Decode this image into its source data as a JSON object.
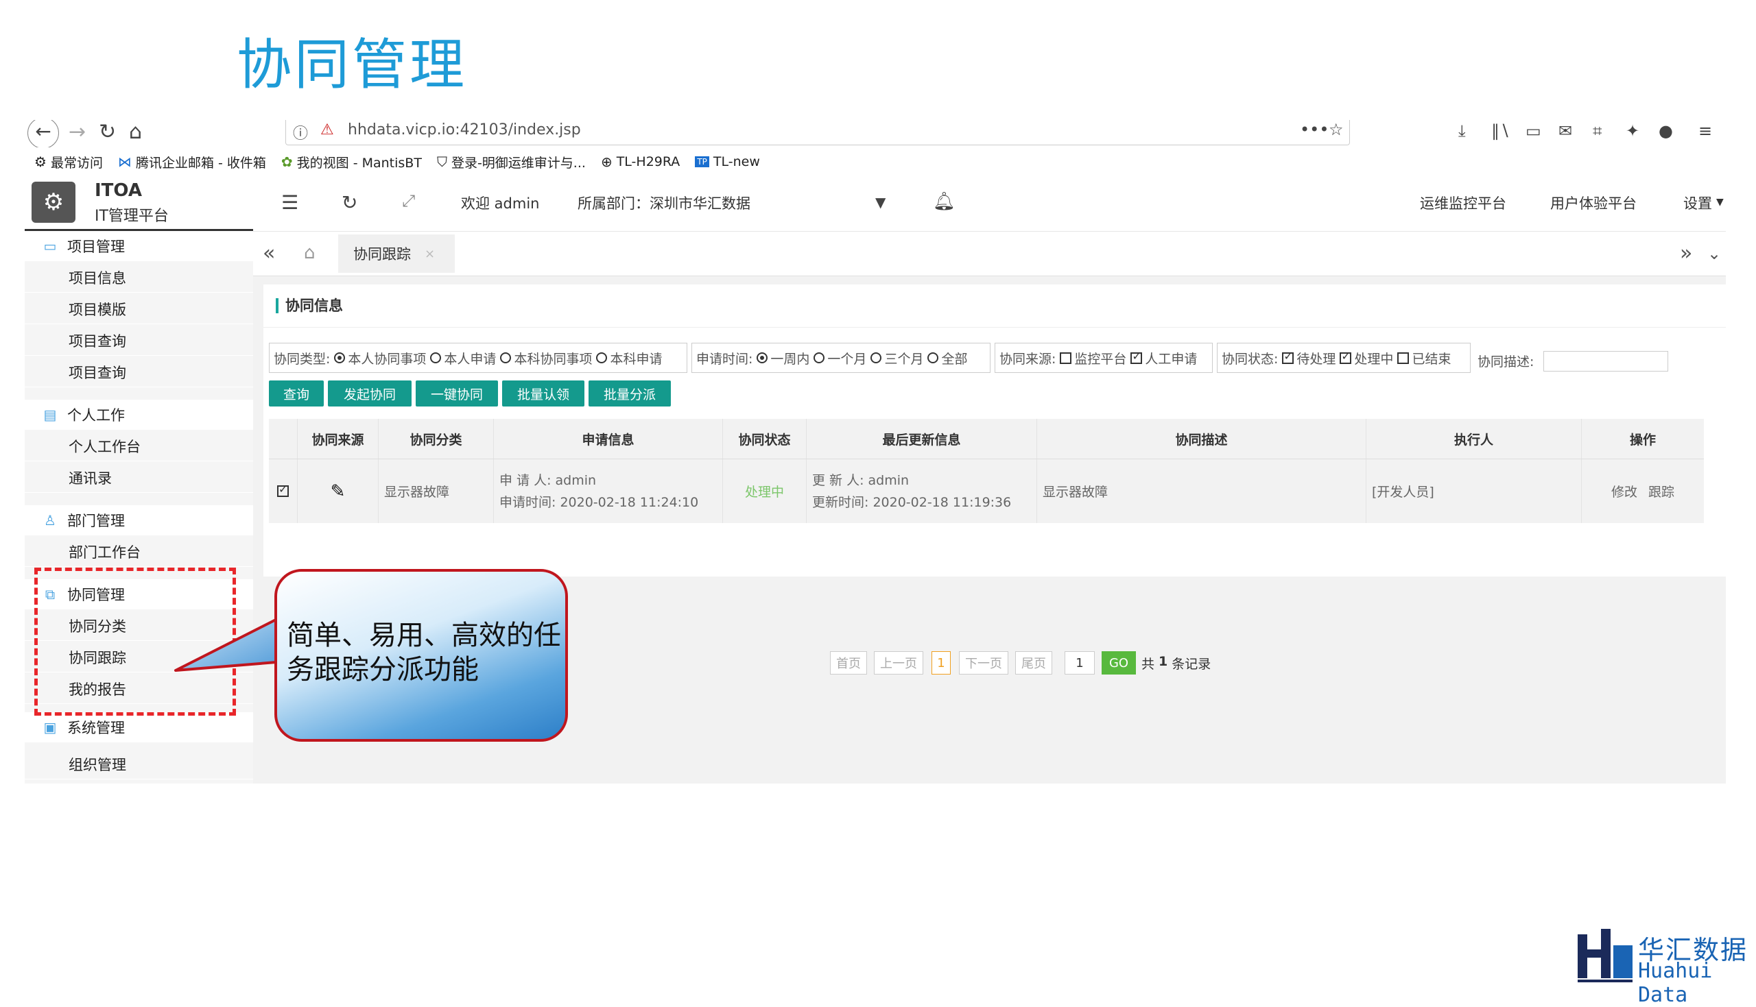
{
  "slide": {
    "title": "协同管理"
  },
  "browser": {
    "url": "hhdata.vicp.io:42103/index.jsp",
    "bookmarks": [
      {
        "icon": "gear-icon",
        "label": "最常访问"
      },
      {
        "icon": "mail-icon",
        "label": "腾讯企业邮箱 - 收件箱"
      },
      {
        "icon": "bug-icon",
        "label": "我的视图 - MantisBT"
      },
      {
        "icon": "shield-icon",
        "label": "登录-明御运维审计与..."
      },
      {
        "icon": "globe-icon",
        "label": "TL-H29RA"
      },
      {
        "icon": "tp-icon",
        "label": "TL-new"
      }
    ]
  },
  "app": {
    "logo_title": "ITOA",
    "logo_subtitle": "IT管理平台",
    "welcome": "欢迎 admin",
    "department": "所属部门：深圳市华汇数据",
    "header_links": [
      "运维监控平台",
      "用户体验平台",
      "设置"
    ]
  },
  "sidebar": {
    "groups": [
      {
        "label": "项目管理",
        "items": [
          "项目信息",
          "项目模版",
          "项目查询",
          "项目查询"
        ]
      },
      {
        "label": "个人工作",
        "items": [
          "个人工作台",
          "通讯录"
        ]
      },
      {
        "label": "部门管理",
        "items": [
          "部门工作台"
        ]
      },
      {
        "label": "协同管理",
        "items": [
          "协同分类",
          "协同跟踪",
          "我的报告"
        ]
      },
      {
        "label": "系统管理",
        "items": [
          "组织管理"
        ]
      }
    ]
  },
  "tabs": {
    "active": "协同跟踪"
  },
  "panel": {
    "title": "协同信息",
    "filters": {
      "type_label": "协同类型:",
      "type_options": [
        "本人协同事项",
        "本人申请",
        "本科协同事项",
        "本科申请"
      ],
      "time_label": "申请时间:",
      "time_options": [
        "一周内",
        "一个月",
        "三个月",
        "全部"
      ],
      "source_label": "协同来源:",
      "source_options": [
        "监控平台",
        "人工申请"
      ],
      "status_label": "协同状态:",
      "status_options": [
        "待处理",
        "处理中",
        "已结束"
      ],
      "desc_label": "协同描述:"
    },
    "buttons": [
      "查询",
      "发起协同",
      "一键协同",
      "批量认领",
      "批量分派"
    ],
    "table": {
      "headers": [
        "协同来源",
        "协同分类",
        "申请信息",
        "协同状态",
        "最后更新信息",
        "协同描述",
        "执行人",
        "操作"
      ],
      "rows": [
        {
          "category": "显示器故障",
          "applicant": "申 请 人: admin",
          "apply_time": "申请时间: 2020-02-18 11:24:10",
          "status": "处理中",
          "updater": "更 新 人: admin",
          "update_time": "更新时间: 2020-02-18 11:19:36",
          "description": "显示器故障",
          "executor": "[开发人员]",
          "action_edit": "修改",
          "action_track": "跟踪"
        }
      ]
    },
    "pagination": {
      "first": "首页",
      "prev": "上一页",
      "current": "1",
      "next": "下一页",
      "last": "尾页",
      "jump_value": "1",
      "go": "GO",
      "total_prefix": "共",
      "total_count": "1",
      "total_suffix": "条记录"
    }
  },
  "callout": {
    "text": "简单、易用、高效的任务跟踪分派功能"
  },
  "brand": {
    "cn": "华汇数据",
    "en": "Huahui Data"
  },
  "colors": {
    "title": "#1e9bd7",
    "button": "#149a8d",
    "status": "#7cc66a",
    "highlight": "#e8262a"
  }
}
